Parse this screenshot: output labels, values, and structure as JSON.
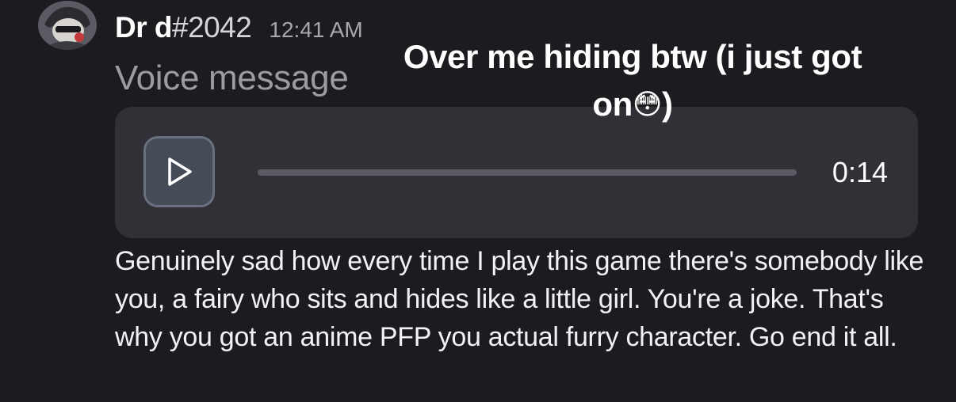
{
  "message": {
    "author": {
      "username": "Dr d",
      "discriminator": "#2042",
      "avatar_icon": "user-avatar-icon"
    },
    "timestamp": "12:41 AM",
    "attachment_label": "Voice message",
    "voice_player": {
      "play_icon": "play-icon",
      "duration": "0:14",
      "progress": 0
    },
    "body_text": "Genuinely sad how every time I play this game there's somebody like you, a fairy who sits and hides like a little girl. You're a joke. That's why you got an anime PFP you actual furry character. Go end it all."
  },
  "overlay": {
    "caption": "Over me hiding btw (i just got on",
    "emoji": "😳",
    "caption_end": ")"
  },
  "colors": {
    "background": "#1c1c20",
    "card": "#303036",
    "muted_text": "#9b9ba2",
    "play_button": "#454b57"
  }
}
